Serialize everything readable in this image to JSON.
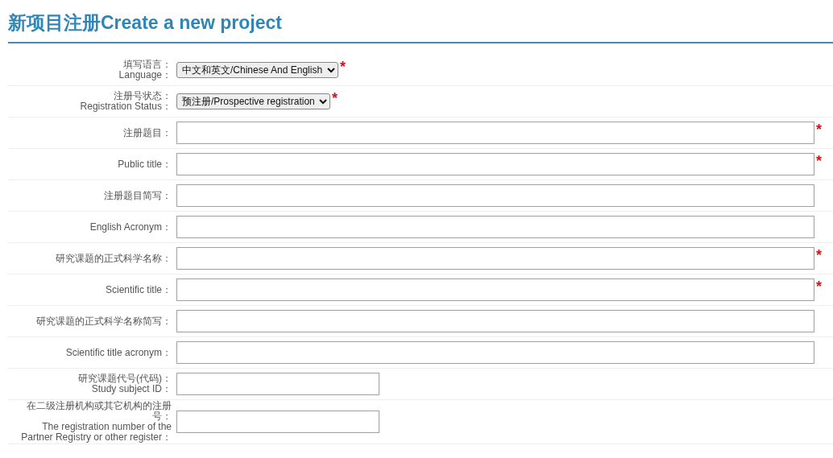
{
  "page": {
    "title": "新项目注册Create a new project"
  },
  "form": {
    "rows": [
      {
        "kind": "select",
        "labels": [
          "填写语言：",
          "Language："
        ],
        "value": "中文和英文/Chinese And English",
        "mark": "*"
      },
      {
        "kind": "select",
        "labels": [
          "注册号状态：",
          "Registration Status："
        ],
        "value": "预注册/Prospective registration",
        "mark": "*"
      },
      {
        "kind": "text",
        "labels": [
          "注册题目："
        ],
        "mark": "*"
      },
      {
        "kind": "text",
        "labels": [
          "Public title："
        ],
        "mark": "*"
      },
      {
        "kind": "text",
        "labels": [
          "注册题目简写："
        ]
      },
      {
        "kind": "text",
        "labels": [
          "English Acronym："
        ]
      },
      {
        "kind": "text",
        "labels": [
          "研究课题的正式科学名称："
        ],
        "mark": "*"
      },
      {
        "kind": "text",
        "labels": [
          "Scientific title："
        ],
        "mark": "*"
      },
      {
        "kind": "text",
        "labels": [
          "研究课题的正式科学名称简写："
        ]
      },
      {
        "kind": "text",
        "labels": [
          "Scientific title acronym："
        ]
      },
      {
        "kind": "short",
        "labels": [
          "研究课题代号(代码)：",
          "Study subject ID："
        ]
      },
      {
        "kind": "short",
        "labels": [
          "在二级注册机构或其它机构的注册号：",
          "The registration number of the Partner Registry or other register："
        ]
      }
    ]
  }
}
